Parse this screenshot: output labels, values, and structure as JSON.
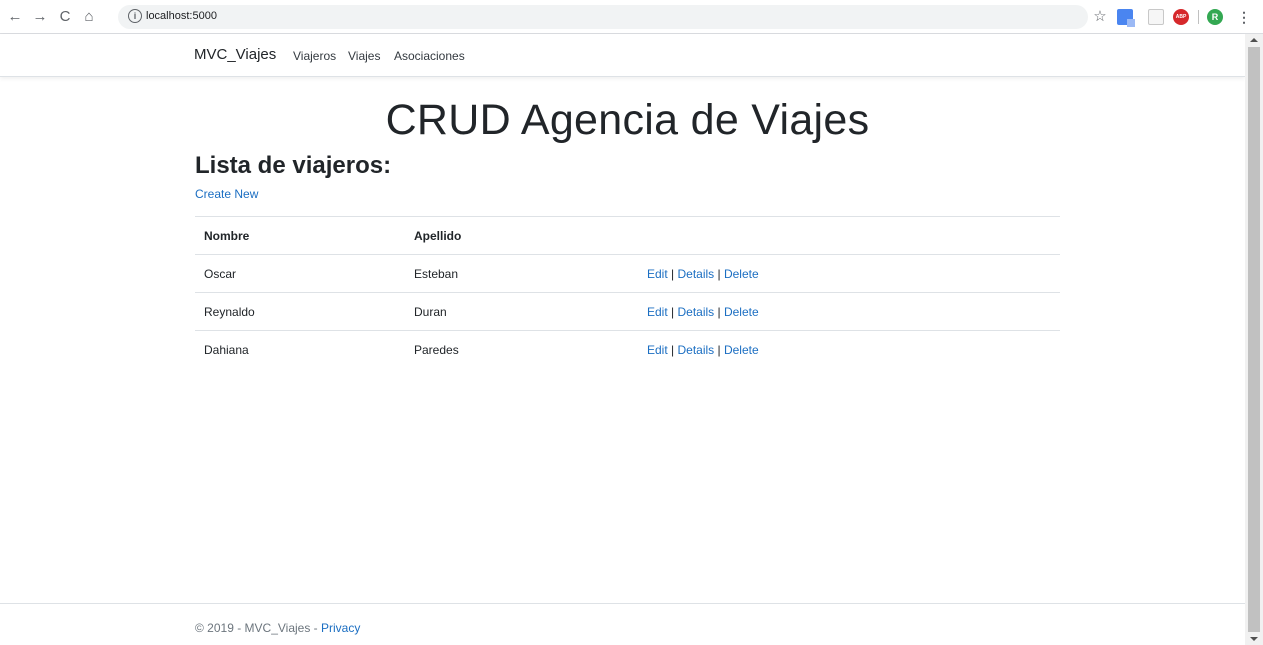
{
  "browser": {
    "url": "localhost:5000",
    "back_icon": "←",
    "forward_icon": "→",
    "reload_icon": "C",
    "home_icon": "⌂",
    "info_icon": "i",
    "star_icon": "☆",
    "abp_label": "ABP",
    "avatar_letter": "R",
    "menu_icon": "⋮"
  },
  "navbar": {
    "brand": "MVC_Viajes",
    "links": [
      "Viajeros",
      "Viajes",
      "Asociaciones"
    ]
  },
  "main": {
    "hero_title": "CRUD Agencia de Viajes",
    "heading": "Lista de viajeros:",
    "create_link": "Create New",
    "table": {
      "headers": [
        "Nombre",
        "Apellido"
      ],
      "rows": [
        {
          "nombre": "Oscar",
          "apellido": "Esteban"
        },
        {
          "nombre": "Reynaldo",
          "apellido": "Duran"
        },
        {
          "nombre": "Dahiana",
          "apellido": "Paredes"
        }
      ],
      "actions": {
        "edit": "Edit",
        "details": "Details",
        "delete": "Delete",
        "separator": " | "
      }
    }
  },
  "footer": {
    "prefix": "© 2019 - MVC_Viajes - ",
    "privacy": "Privacy"
  },
  "colors": {
    "link": "#1b6ec2",
    "text": "#212529",
    "border": "#dee2e6"
  }
}
